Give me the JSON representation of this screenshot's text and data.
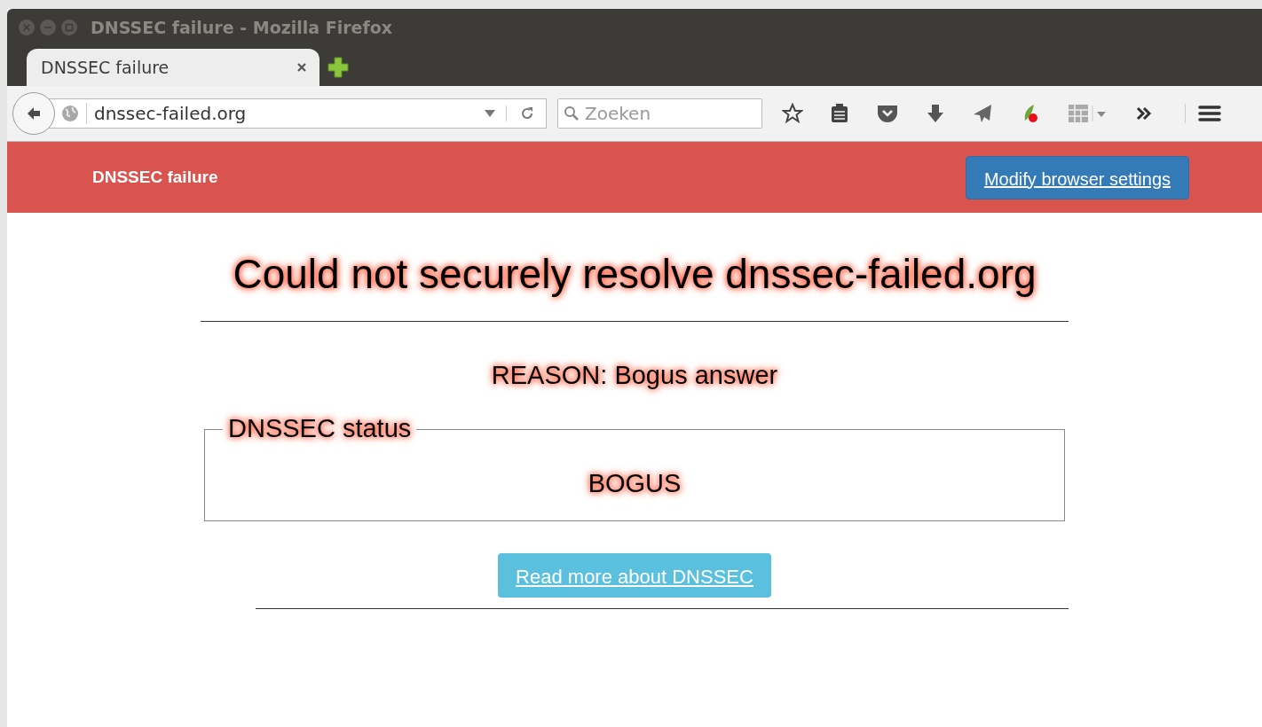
{
  "window": {
    "title": "DNSSEC failure - Mozilla Firefox"
  },
  "tabs": [
    {
      "label": "DNSSEC failure",
      "selected": true
    }
  ],
  "url_bar": {
    "value": "dnssec-failed.org"
  },
  "search": {
    "placeholder": "Zoeken"
  },
  "page": {
    "header_title": "DNSSEC failure",
    "settings_button": "Modify browser settings",
    "heading": "Could not securely resolve dnssec-failed.org",
    "reason": "REASON: Bogus answer",
    "status_legend": "DNSSEC status",
    "status_value": "BOGUS",
    "read_more": "Read more about DNSSEC"
  }
}
